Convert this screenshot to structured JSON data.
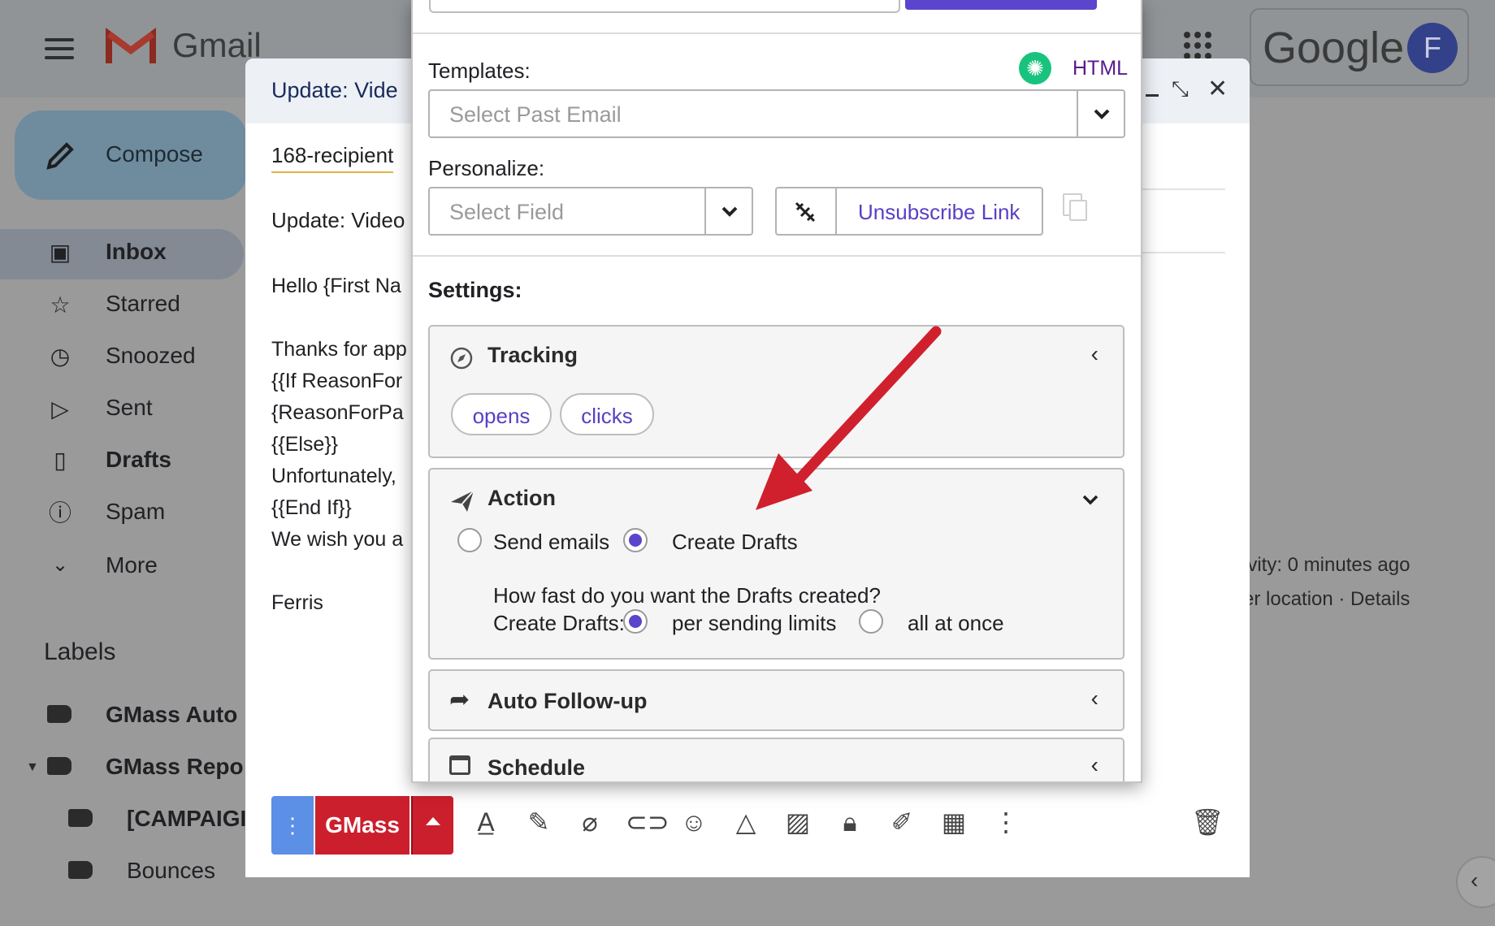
{
  "gmail": {
    "app_name": "Gmail",
    "google_label": "Google",
    "avatar_letter": "F",
    "compose_label": "Compose",
    "nav": [
      {
        "label": "Inbox",
        "icon": "inbox-icon",
        "bold": true
      },
      {
        "label": "Starred",
        "icon": "star-icon"
      },
      {
        "label": "Snoozed",
        "icon": "clock-icon"
      },
      {
        "label": "Sent",
        "icon": "send-icon"
      },
      {
        "label": "Drafts",
        "icon": "draft-icon",
        "bold": true
      },
      {
        "label": "Spam",
        "icon": "spam-icon"
      },
      {
        "label": "More",
        "icon": "chevron-down-icon"
      }
    ],
    "labels_heading": "Labels",
    "labels": [
      "GMass Auto",
      "GMass Repo",
      "[CAMPAIGI",
      "Bounces"
    ],
    "activity_line1": "ivity: 0 minutes ago",
    "activity_line2": "er location · Details"
  },
  "compose": {
    "title": "Update: Vide",
    "to_value": "168-recipient",
    "subject": "Update: Video",
    "body_lines": [
      "Hello {First Na",
      "",
      "Thanks for app",
      "{{If ReasonFor",
      "{ReasonForPa",
      "{{Else}}",
      "Unfortunately, ",
      "{{End If}}",
      "We wish you a",
      "",
      "Ferris"
    ],
    "gmass_button": "GMass"
  },
  "popup": {
    "templates_label": "Templates:",
    "html_link": "HTML",
    "templates_placeholder": "Select Past Email",
    "personalize_label": "Personalize:",
    "field_placeholder": "Select Field",
    "unsubscribe_label": "Unsubscribe Link",
    "settings_label": "Settings:",
    "tracking": {
      "title": "Tracking",
      "chips": [
        "opens",
        "clicks"
      ]
    },
    "action": {
      "title": "Action",
      "send_emails": "Send emails",
      "create_drafts": "Create Drafts",
      "selected": "Create Drafts",
      "question": "How fast do you want the Drafts created?",
      "speed_label": "Create Drafts:",
      "speed_option1": "per sending limits",
      "speed_option2": "all at once",
      "speed_selected": "per sending limits"
    },
    "followup": {
      "title": "Auto Follow-up"
    },
    "schedule": {
      "title": "Schedule"
    }
  },
  "colors": {
    "accent": "#5b45cc",
    "gmass_red": "#cc1f2d",
    "annotation_arrow": "#d0202e"
  }
}
